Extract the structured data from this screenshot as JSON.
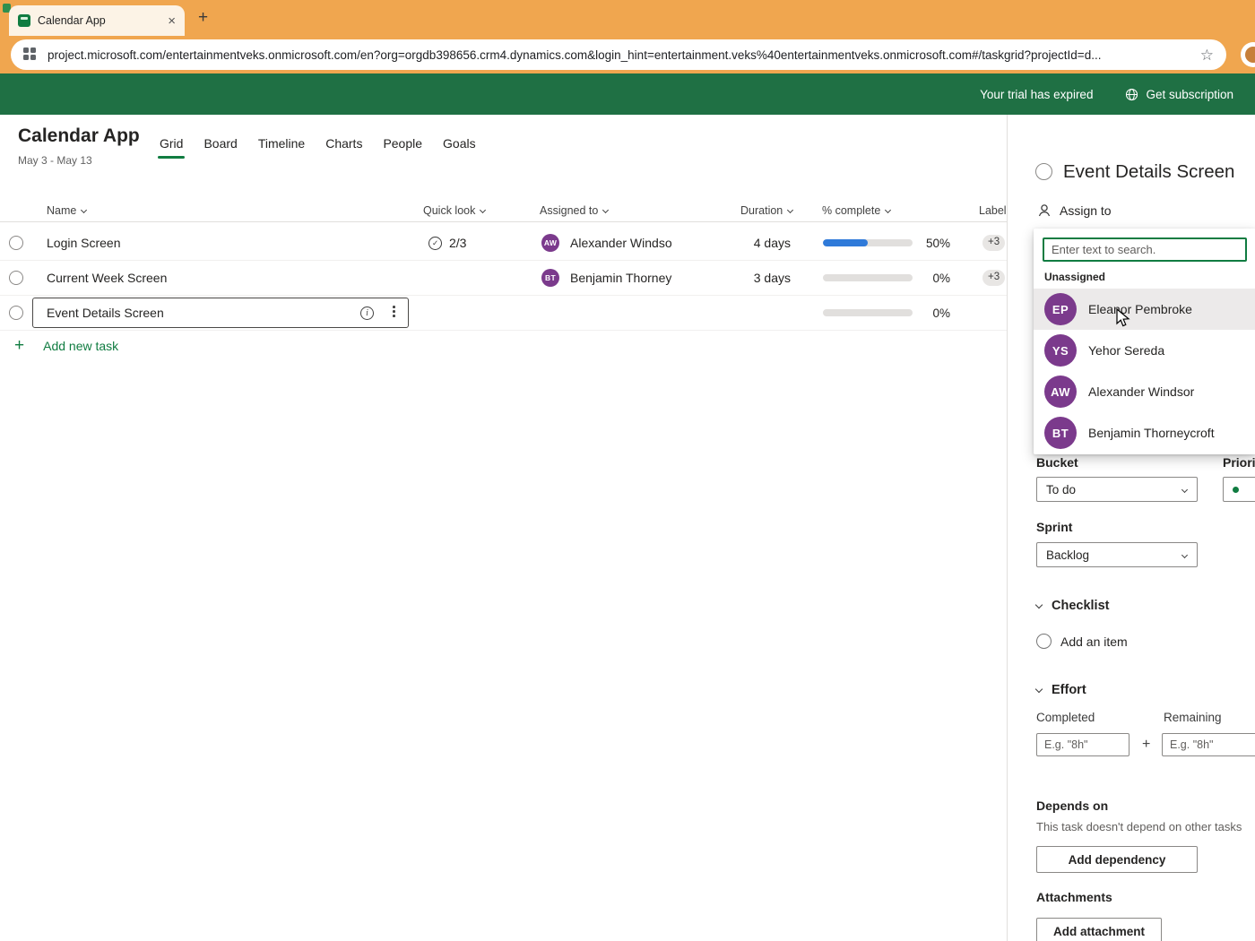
{
  "browser": {
    "tab_title": "Calendar App",
    "url": "project.microsoft.com/entertainmentveks.onmicrosoft.com/en?org=orgdb398656.crm4.dynamics.com&login_hint=entertainment.veks%40entertainmentveks.onmicrosoft.com#/taskgrid?projectId=d...",
    "new_tab": "+",
    "close_tab": "×",
    "star": "☆"
  },
  "banner": {
    "trial_text": "Your trial has expired",
    "subscription_text": "Get subscription"
  },
  "header": {
    "title": "Calendar App",
    "date_range": "May 3 - May 13",
    "tabs": [
      {
        "label": "Grid"
      },
      {
        "label": "Board"
      },
      {
        "label": "Timeline"
      },
      {
        "label": "Charts"
      },
      {
        "label": "People"
      },
      {
        "label": "Goals"
      }
    ]
  },
  "table": {
    "columns": [
      "Name",
      "Quick look",
      "Assigned to",
      "Duration",
      "% complete",
      "Labels"
    ],
    "rows": [
      {
        "name": "Login Screen",
        "quick_look": "2/3",
        "assignee": {
          "initials": "AW",
          "name": "Alexander Windso"
        },
        "duration": "4 days",
        "percent": 50,
        "percent_label": "50%",
        "labels": "+3"
      },
      {
        "name": "Current Week Screen",
        "assignee": {
          "initials": "BT",
          "name": "Benjamin Thorney"
        },
        "duration": "3 days",
        "percent": 0,
        "percent_label": "0%",
        "labels": "+3"
      },
      {
        "name": "Event Details Screen",
        "percent": 0,
        "percent_label": "0%"
      }
    ],
    "add_task_label": "Add new task"
  },
  "panel": {
    "title": "Event Details Screen",
    "assign_to_label": "Assign to",
    "search_placeholder": "Enter text to search.",
    "unassigned_label": "Unassigned",
    "people": [
      {
        "initials": "EP",
        "name": "Eleanor Pembroke"
      },
      {
        "initials": "YS",
        "name": "Yehor Sereda"
      },
      {
        "initials": "AW",
        "name": "Alexander Windsor"
      },
      {
        "initials": "BT",
        "name": "Benjamin Thorneycroft"
      }
    ],
    "bucket_label": "Bucket",
    "bucket_value": "To do",
    "priority_label": "Priority",
    "sprint_label": "Sprint",
    "sprint_value": "Backlog",
    "checklist_label": "Checklist",
    "add_item_label": "Add an item",
    "effort_label": "Effort",
    "completed_label": "Completed",
    "remaining_label": "Remaining",
    "effort_placeholder": "E.g. \"8h\"",
    "depends_label": "Depends on",
    "depends_text": "This task doesn't depend on other tasks",
    "add_dependency_label": "Add dependency",
    "attachments_label": "Attachments",
    "add_attachment_label": "Add attachment"
  },
  "colors": {
    "accent_green": "#107c41",
    "banner_green": "#1f7044",
    "browser_orange": "#f0a64f",
    "tab_cream": "#fcf3e6",
    "avatar_purple": "#7b3a8c",
    "progress_blue": "#2f7ad9"
  }
}
